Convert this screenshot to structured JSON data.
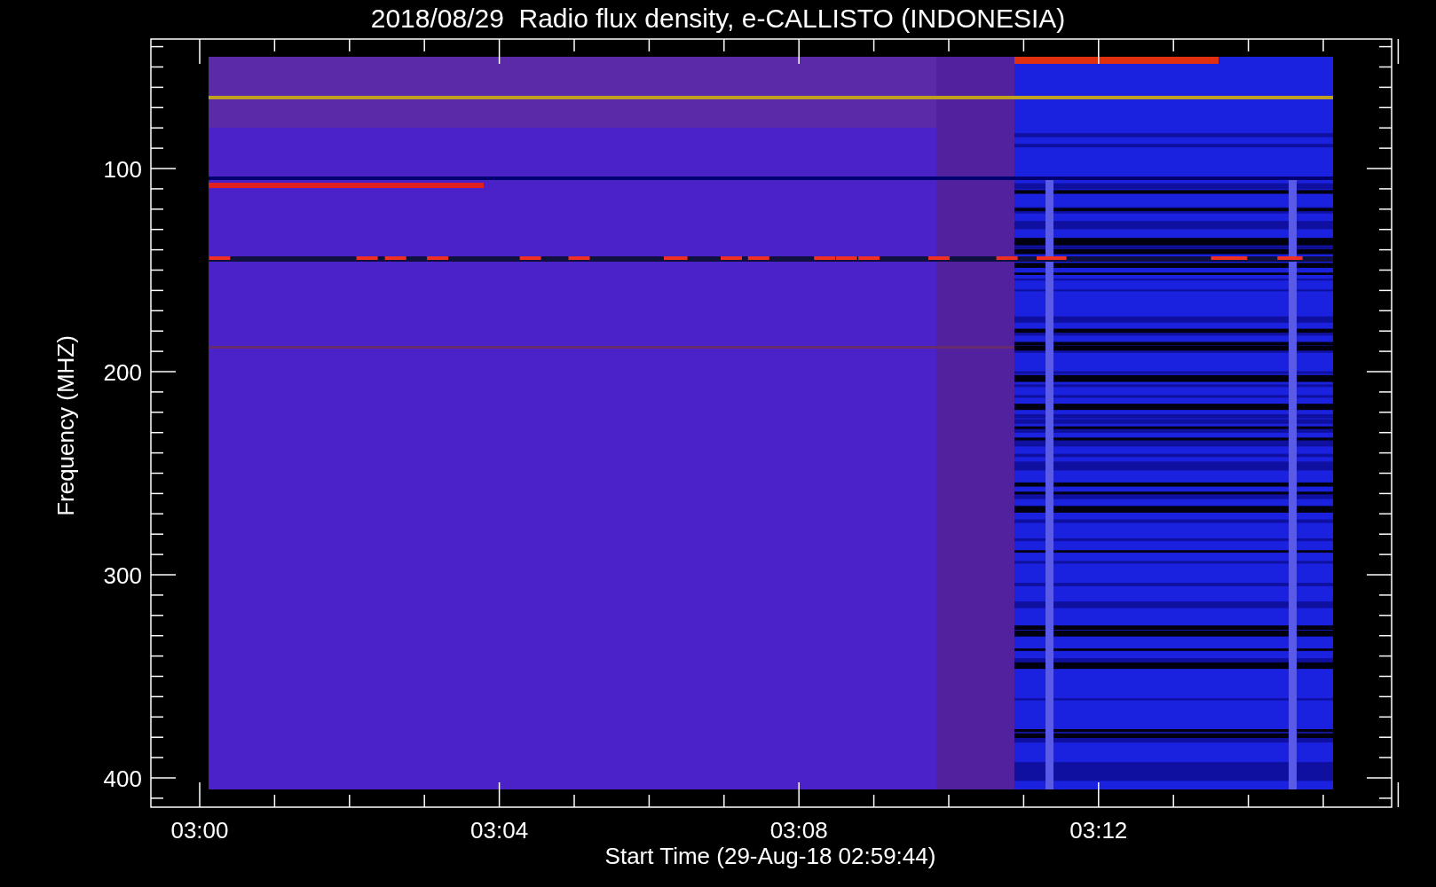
{
  "title": "2018/08/29  Radio flux density, e-CALLISTO (INDONESIA)",
  "y_axis": {
    "title": "Frequency (MHZ)",
    "ticks": [
      "100",
      "200",
      "300",
      "400"
    ]
  },
  "x_axis": {
    "title": "Start Time (29-Aug-18 02:59:44)",
    "ticks": [
      "03:00",
      "03:04",
      "03:08",
      "03:12"
    ]
  }
}
